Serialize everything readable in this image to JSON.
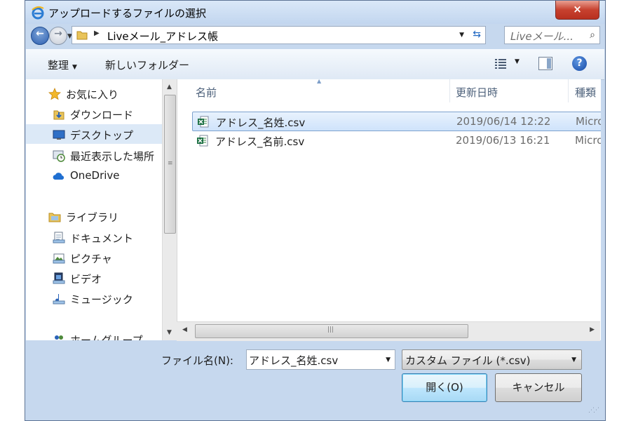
{
  "window": {
    "title": "アップロードするファイルの選択",
    "close_label": "×"
  },
  "address": {
    "path": "Liveメール_アドレス帳",
    "search_placeholder": "Liveメール..."
  },
  "toolbar": {
    "organize_label": "整理",
    "new_folder_label": "新しいフォルダー",
    "help_label": "?"
  },
  "nav": {
    "items": [
      {
        "label": "お気に入り",
        "icon": "star-icon"
      },
      {
        "label": "ダウンロード",
        "icon": "downloads-folder-icon"
      },
      {
        "label": "デスクトップ",
        "icon": "desktop-icon",
        "selected": true
      },
      {
        "label": "最近表示した場所",
        "icon": "recent-places-icon"
      },
      {
        "label": "OneDrive",
        "icon": "cloud-icon"
      },
      {
        "label": "ライブラリ",
        "icon": "library-folder-icon"
      },
      {
        "label": "ドキュメント",
        "icon": "documents-icon"
      },
      {
        "label": "ピクチャ",
        "icon": "pictures-icon"
      },
      {
        "label": "ビデオ",
        "icon": "video-icon"
      },
      {
        "label": "ミュージック",
        "icon": "music-icon"
      },
      {
        "label": "ホームグループ",
        "icon": "homegroup-icon"
      }
    ]
  },
  "columns": {
    "name": "名前",
    "date": "更新日時",
    "type": "種類"
  },
  "files": [
    {
      "name": "アドレス_名姓.csv",
      "date": "2019/06/14 12:22",
      "type": "Micro",
      "selected": true,
      "icon": "excel-csv-icon"
    },
    {
      "name": "アドレス_名前.csv",
      "date": "2019/06/13 16:21",
      "type": "Micro",
      "selected": false,
      "icon": "excel-csv-icon"
    }
  ],
  "footer": {
    "filename_label": "ファイル名(N):",
    "filename_value": "アドレス_名姓.csv",
    "filter_value": "カスタム ファイル (*.csv)",
    "open_label": "開く(O)",
    "cancel_label": "キャンセル"
  }
}
